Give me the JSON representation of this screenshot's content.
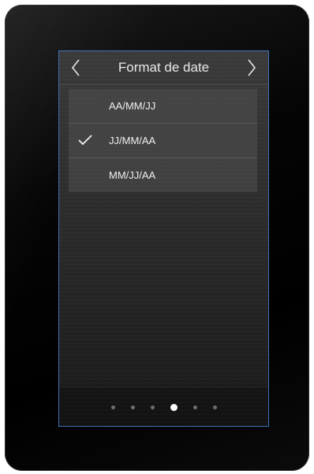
{
  "screen": {
    "title": "Format de date",
    "nav": {
      "prev_icon": "chevron-left-icon",
      "next_icon": "chevron-right-icon"
    },
    "options": [
      {
        "label": "AA/MM/JJ",
        "selected": false
      },
      {
        "label": "JJ/MM/AA",
        "selected": true
      },
      {
        "label": "MM/JJ/AA",
        "selected": false
      }
    ],
    "pager": {
      "total": 6,
      "active_index": 3
    }
  },
  "colors": {
    "screen_border": "#3f6fb8",
    "text": "#f0f0f0",
    "dot_active": "#ffffff",
    "dot_inactive": "#6e6e6e"
  }
}
